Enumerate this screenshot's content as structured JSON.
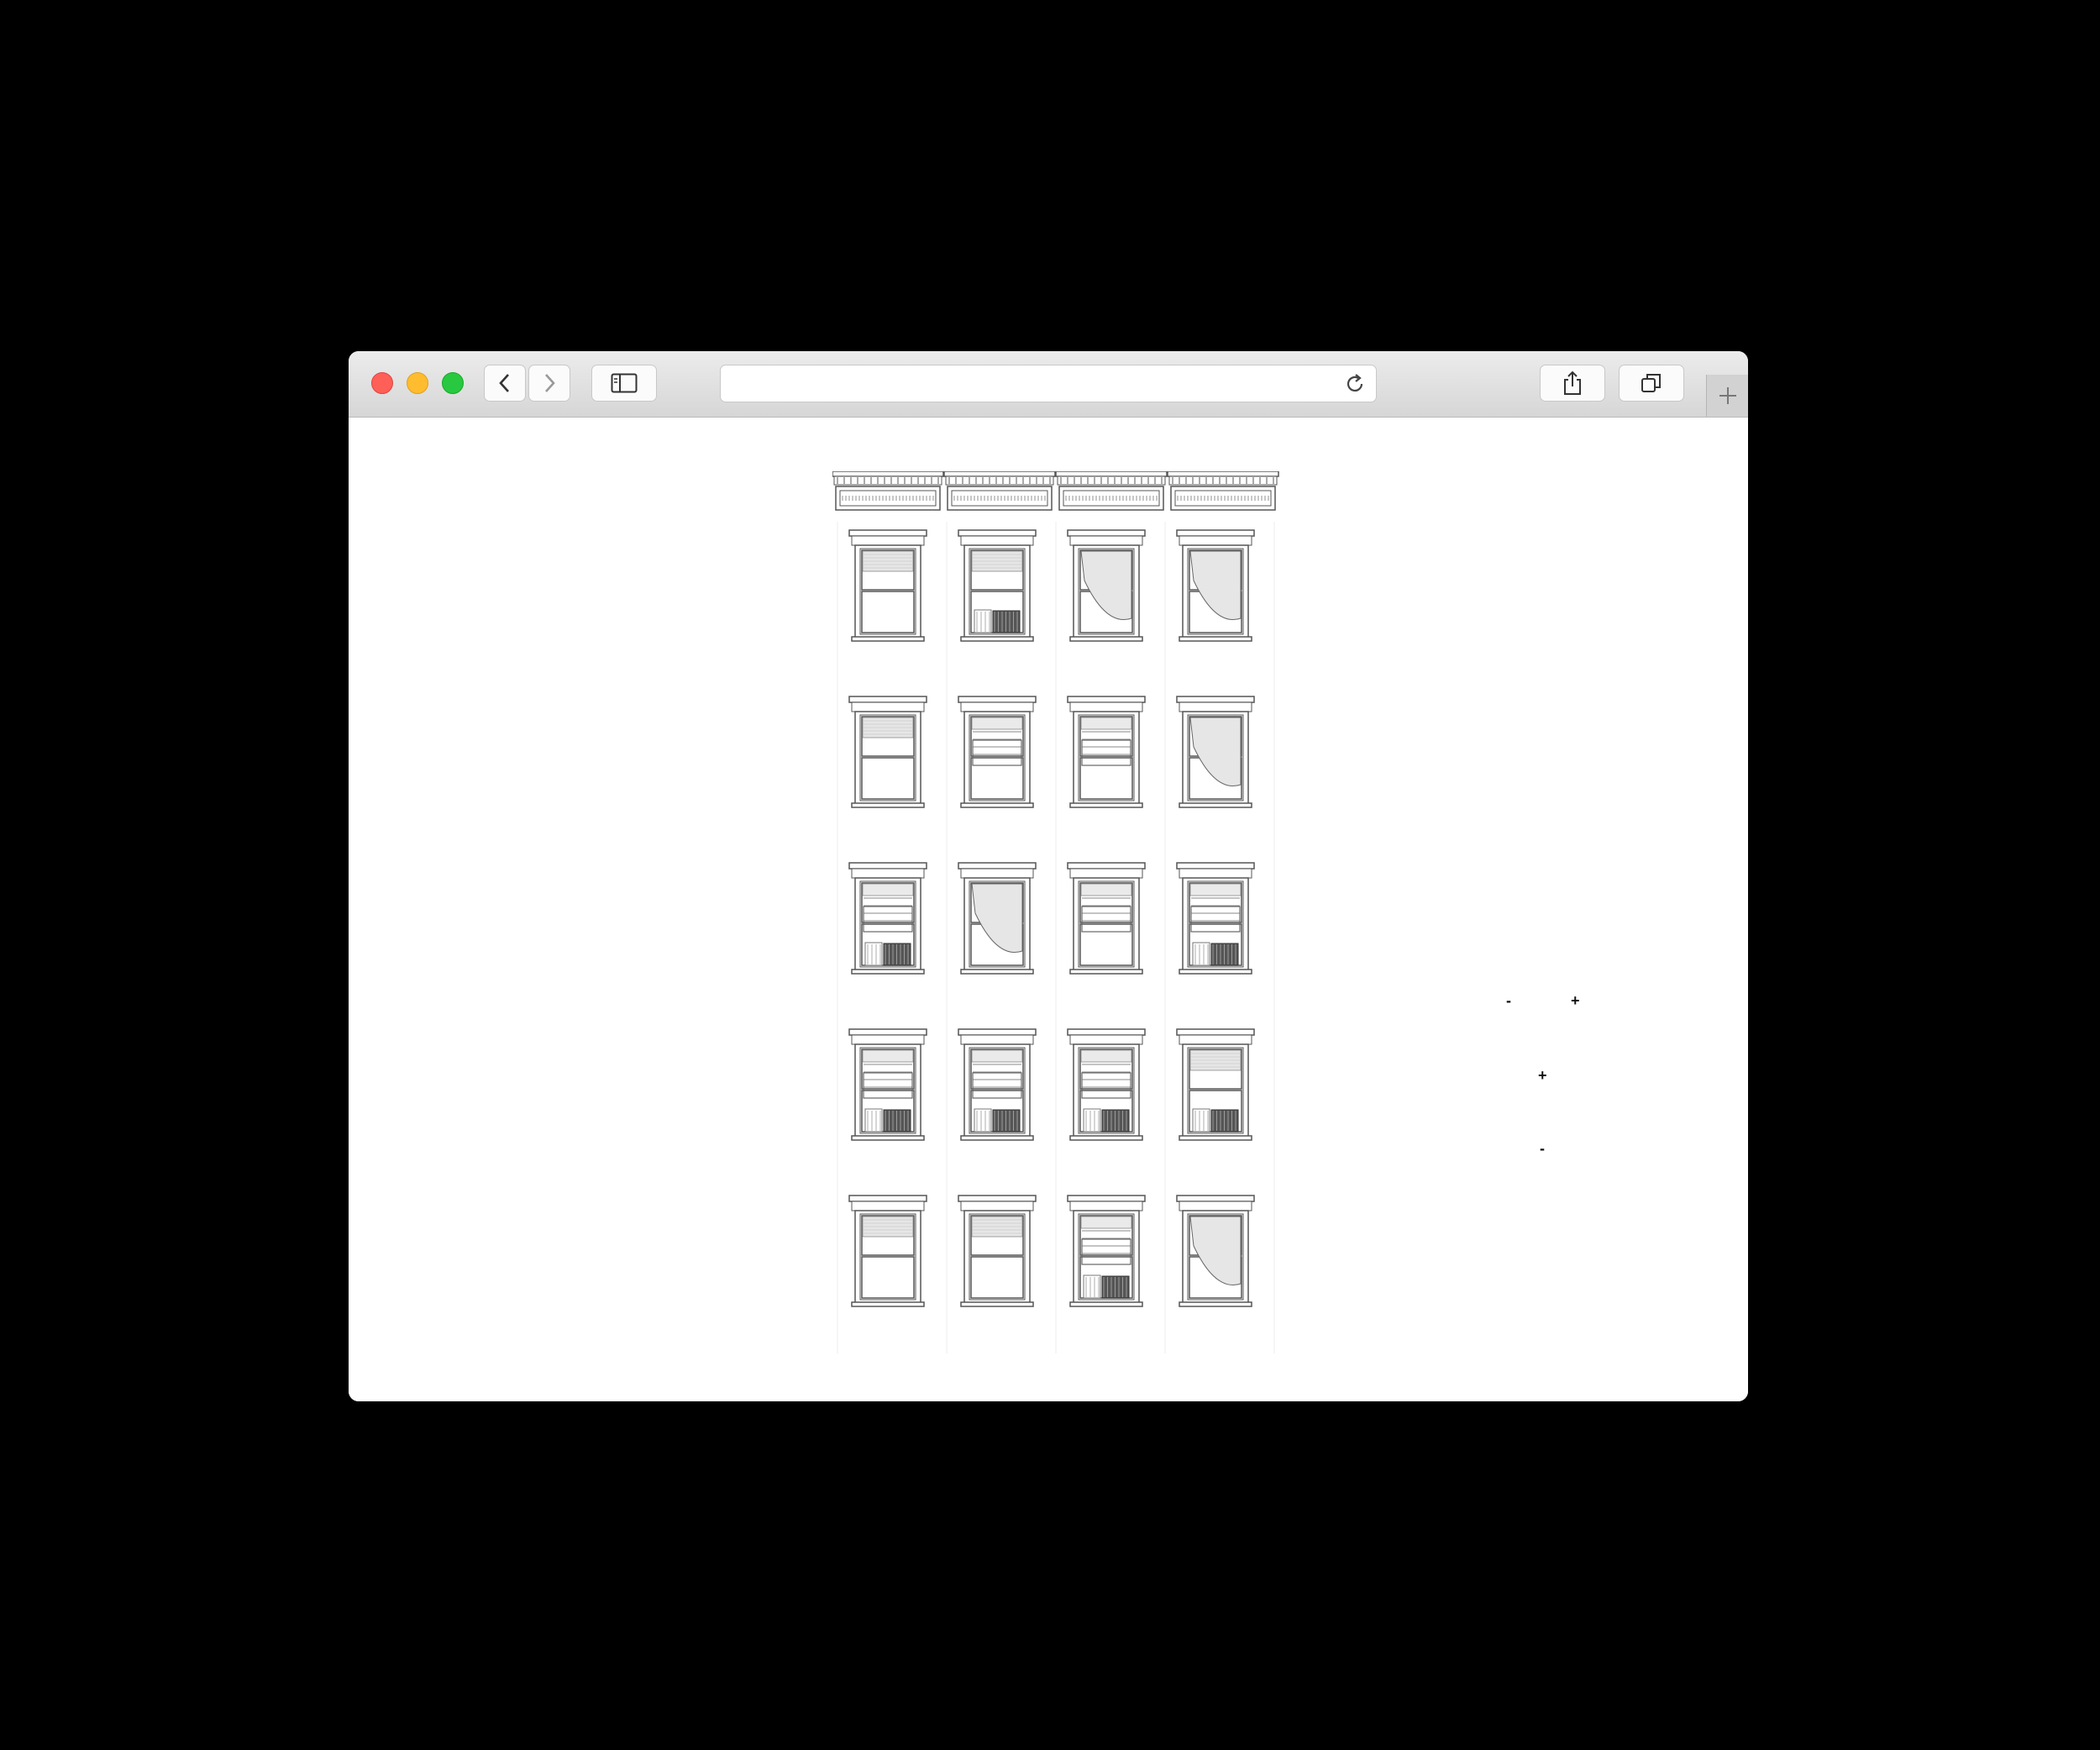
{
  "browser": {
    "url": "",
    "icons": [
      "back-chevron-icon",
      "forward-chevron-icon",
      "sidebar-icon",
      "reload-icon",
      "share-icon",
      "tabs-overview-icon",
      "plus-icon"
    ]
  },
  "controls": {
    "row1_minus": "-",
    "row1_plus": "+",
    "row2_plus": "+",
    "row3_minus": "-"
  },
  "building": {
    "floors": 5,
    "columns": 4,
    "windows": [
      [
        "shade",
        "shade-ac",
        "curtain",
        "curtain"
      ],
      [
        "shade",
        "blinds",
        "blinds",
        "curtain"
      ],
      [
        "blinds-ac",
        "curtain",
        "blinds",
        "blinds-ac"
      ],
      [
        "blinds-ac",
        "blinds-ac",
        "blinds-ac",
        "shade-ac"
      ],
      [
        "shade",
        "shade",
        "blinds-ac",
        "curtain"
      ]
    ]
  }
}
